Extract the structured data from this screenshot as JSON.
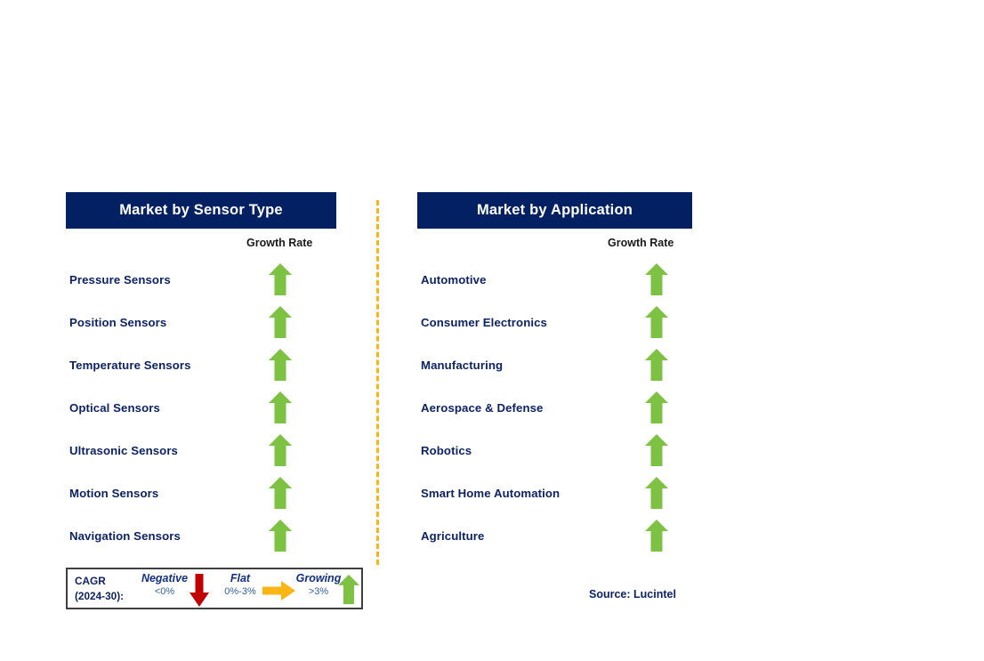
{
  "colors": {
    "header_bg": "#032063",
    "header_text": "#ffffff",
    "label_text": "#0d2364",
    "growth_green": "#7DC242",
    "negative_red": "#C00000",
    "flat_orange": "#FBB615",
    "divider_orange": "#FBB615",
    "legend_border": "#3f3f3f"
  },
  "panels": [
    {
      "id": "market-by-sensor-type",
      "title": "Market by Sensor Type",
      "growth_rate_label": "Growth Rate",
      "rows": [
        {
          "label": "Pressure Sensors",
          "growth": "growing",
          "icon": "arrow-up-icon"
        },
        {
          "label": "Position Sensors",
          "growth": "growing",
          "icon": "arrow-up-icon"
        },
        {
          "label": "Temperature Sensors",
          "growth": "growing",
          "icon": "arrow-up-icon"
        },
        {
          "label": "Optical Sensors",
          "growth": "growing",
          "icon": "arrow-up-icon"
        },
        {
          "label": "Ultrasonic Sensors",
          "growth": "growing",
          "icon": "arrow-up-icon"
        },
        {
          "label": "Motion Sensors",
          "growth": "growing",
          "icon": "arrow-up-icon"
        },
        {
          "label": "Navigation Sensors",
          "growth": "growing",
          "icon": "arrow-up-icon"
        }
      ]
    },
    {
      "id": "market-by-application",
      "title": "Market by Application",
      "growth_rate_label": "Growth Rate",
      "rows": [
        {
          "label": "Automotive",
          "growth": "growing",
          "icon": "arrow-up-icon"
        },
        {
          "label": "Consumer Electronics",
          "growth": "growing",
          "icon": "arrow-up-icon"
        },
        {
          "label": "Manufacturing",
          "growth": "growing",
          "icon": "arrow-up-icon"
        },
        {
          "label": "Aerospace & Defense",
          "growth": "growing",
          "icon": "arrow-up-icon"
        },
        {
          "label": "Robotics",
          "growth": "growing",
          "icon": "arrow-up-icon"
        },
        {
          "label": "Smart Home Automation",
          "growth": "growing",
          "icon": "arrow-up-icon"
        },
        {
          "label": "Agriculture",
          "growth": "growing",
          "icon": "arrow-up-icon"
        }
      ]
    }
  ],
  "legend": {
    "cagr_line1": "CAGR",
    "cagr_line2": "(2024-30):",
    "items": [
      {
        "title": "Negative",
        "range": "<0%",
        "icon": "arrow-down-icon",
        "color": "#C00000"
      },
      {
        "title": "Flat",
        "range": "0%-3%",
        "icon": "arrow-right-icon",
        "color": "#FBB615"
      },
      {
        "title": "Growing",
        "range": ">3%",
        "icon": "arrow-up-icon",
        "color": "#7DC242"
      }
    ]
  },
  "source": "Source: Lucintel",
  "chart_data": {
    "type": "table",
    "title": "Sensor Market Growth Outlook by Sensor Type and Application",
    "legend_key": [
      {
        "label": "Negative",
        "range": "<0%",
        "symbol": "down arrow",
        "color": "#C00000"
      },
      {
        "label": "Flat",
        "range": "0%-3%",
        "symbol": "right arrow",
        "color": "#FBB615"
      },
      {
        "label": "Growing",
        "range": ">3%",
        "symbol": "up arrow",
        "color": "#7DC242"
      }
    ],
    "cagr_period": "2024-30",
    "series": [
      {
        "name": "Market by Sensor Type",
        "categories": [
          "Pressure Sensors",
          "Position Sensors",
          "Temperature Sensors",
          "Optical Sensors",
          "Ultrasonic Sensors",
          "Motion Sensors",
          "Navigation Sensors"
        ],
        "values": [
          "Growing",
          "Growing",
          "Growing",
          "Growing",
          "Growing",
          "Growing",
          "Growing"
        ]
      },
      {
        "name": "Market by Application",
        "categories": [
          "Automotive",
          "Consumer Electronics",
          "Manufacturing",
          "Aerospace & Defense",
          "Robotics",
          "Smart Home Automation",
          "Agriculture"
        ],
        "values": [
          "Growing",
          "Growing",
          "Growing",
          "Growing",
          "Growing",
          "Growing",
          "Growing"
        ]
      }
    ],
    "source": "Lucintel"
  }
}
